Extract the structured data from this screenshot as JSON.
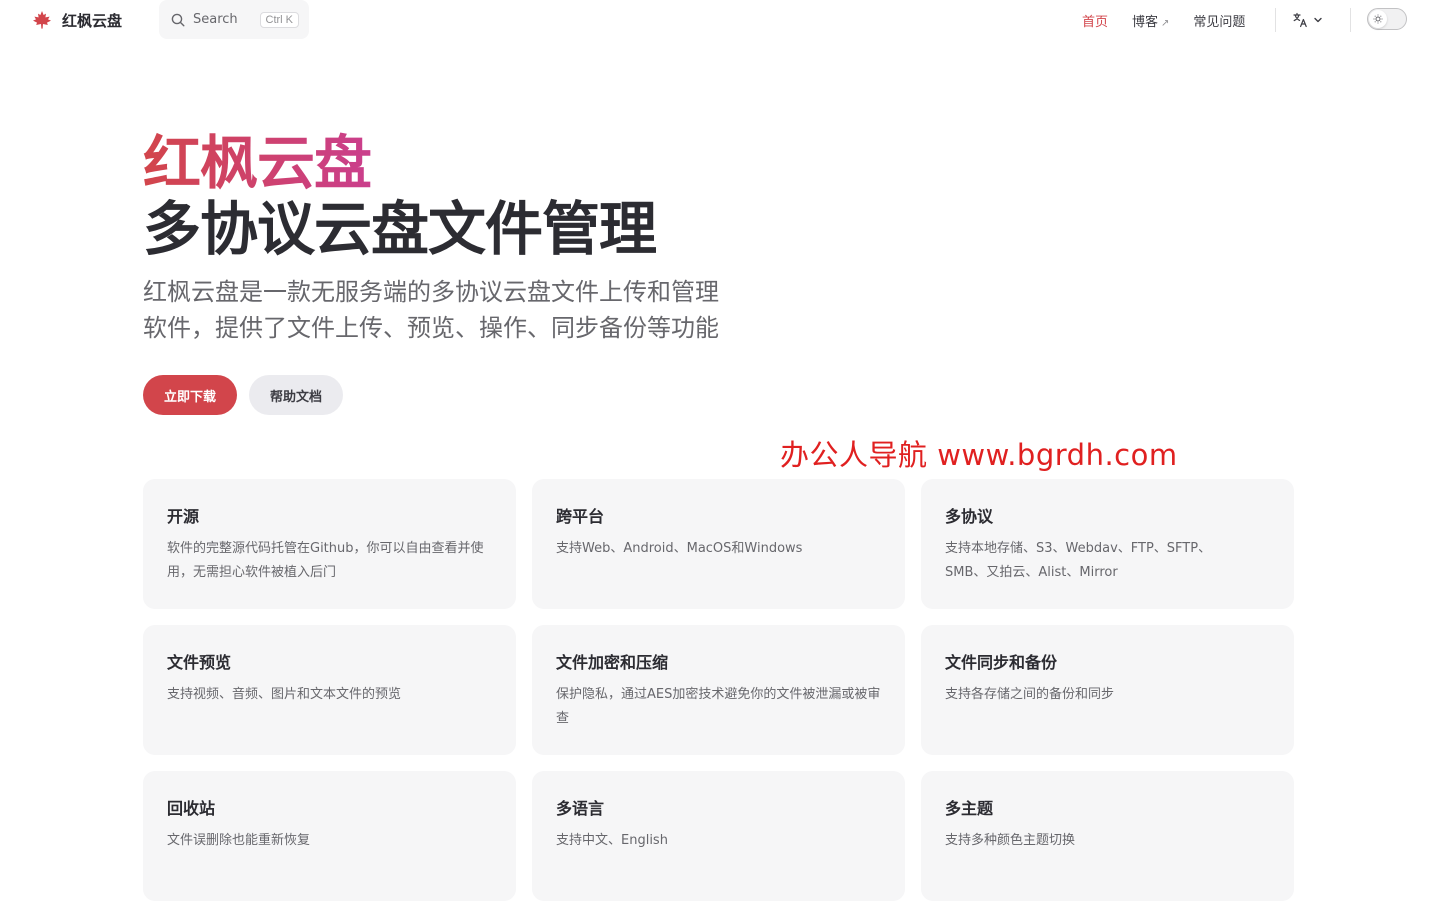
{
  "nav": {
    "brand": "红枫云盘",
    "search_placeholder": "Search",
    "search_kbd": "Ctrl K",
    "links": [
      {
        "label": "首页",
        "active": true
      },
      {
        "label": "博客",
        "external": true,
        "ext_mark": "↗"
      },
      {
        "label": "常见问题"
      }
    ],
    "language_icon": "translate-icon",
    "theme_icon": "sun-icon"
  },
  "hero": {
    "name": "红枫云盘",
    "text": "多协议云盘文件管理",
    "tagline": "红枫云盘是一款无服务端的多协议云盘文件上传和管理软件，提供了文件上传、预览、操作、同步备份等功能",
    "actions": [
      {
        "label": "立即下载",
        "theme": "brand"
      },
      {
        "label": "帮助文档",
        "theme": "alt"
      }
    ]
  },
  "watermark": "办公人导航  www.bgrdh.com",
  "features": [
    {
      "title": "开源",
      "details": "软件的完整源代码托管在Github，你可以自由查看并使用，无需担心软件被植入后门"
    },
    {
      "title": "跨平台",
      "details": "支持Web、Android、MacOS和Windows"
    },
    {
      "title": "多协议",
      "details": "支持本地存储、S3、Webdav、FTP、SFTP、SMB、又拍云、Alist、Mirror"
    },
    {
      "title": "文件预览",
      "details": "支持视频、音频、图片和文本文件的预览"
    },
    {
      "title": "文件加密和压缩",
      "details": "保护隐私，通过AES加密技术避免你的文件被泄漏或被审查"
    },
    {
      "title": "文件同步和备份",
      "details": "支持各存储之间的备份和同步"
    },
    {
      "title": "回收站",
      "details": "文件误删除也能重新恢复"
    },
    {
      "title": "多语言",
      "details": "支持中文、English"
    },
    {
      "title": "多主题",
      "details": "支持多种颜色主题切换"
    }
  ],
  "colors": {
    "brand": "#d2454b",
    "gradient_end": "#bd34fe",
    "watermark": "#e02020"
  }
}
